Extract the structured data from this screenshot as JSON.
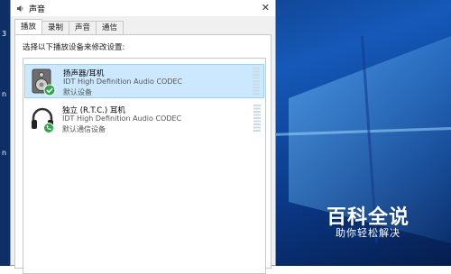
{
  "desktop": {
    "left_strip_chars": [
      "3",
      "n",
      "n"
    ]
  },
  "window": {
    "title": "声音",
    "icons": {
      "title_icon": "speaker-icon",
      "close_icon": "close-icon"
    },
    "close_glyph": "✕"
  },
  "tabs": [
    {
      "label": "播放",
      "active": true
    },
    {
      "label": "录制",
      "active": false
    },
    {
      "label": "声音",
      "active": false
    },
    {
      "label": "通信",
      "active": false
    }
  ],
  "panel": {
    "instruction": "选择以下播放设备来修改设置:"
  },
  "devices": [
    {
      "name": "扬声器/耳机",
      "driver": "IDT High Definition Audio CODEC",
      "status": "默认设备",
      "selected": true,
      "icon": "speaker-icon",
      "badge": "green-check-icon"
    },
    {
      "name": "独立 (R.T.C.) 耳机",
      "driver": "IDT High Definition Audio CODEC",
      "status": "默认通信设备",
      "selected": false,
      "icon": "headphones-icon",
      "badge": "green-phone-icon"
    }
  ],
  "watermark": {
    "main": "百科全说",
    "sub": "助你轻松解决"
  },
  "colors": {
    "selection_bg": "#cce8ff",
    "badge_green": "#2ea84a",
    "desktop_blue": "#1559b8"
  }
}
